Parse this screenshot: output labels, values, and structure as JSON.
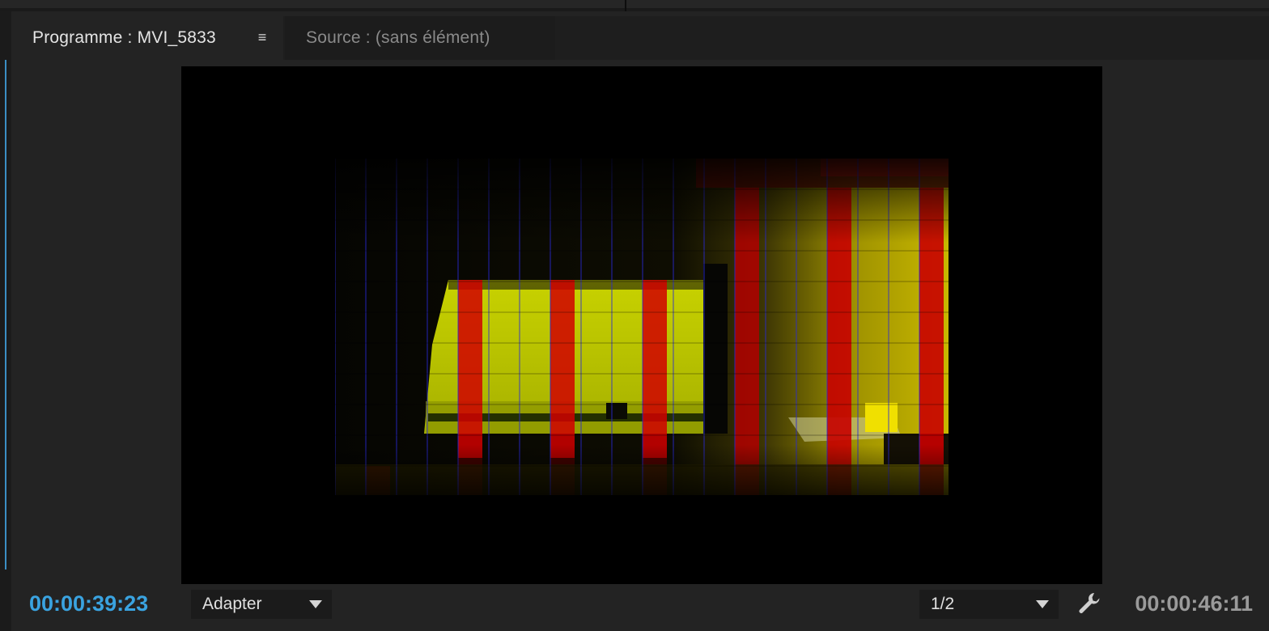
{
  "tabs": [
    {
      "label": "Programme : MVI_5833",
      "active": true
    },
    {
      "label": "Source : (sans élément)",
      "active": false
    }
  ],
  "program_menu_icon": "hamburger-icon",
  "viewer": {
    "content": "video-frame"
  },
  "controls": {
    "current_timecode": "00:00:39:23",
    "fit_label": "Adapter",
    "resolution_label": "1/2",
    "settings_icon": "wrench-icon",
    "duration_timecode": "00:00:46:11"
  },
  "colors": {
    "accent": "#3aa3e0",
    "panel_bg": "#232323",
    "viewer_bg": "#000000"
  }
}
